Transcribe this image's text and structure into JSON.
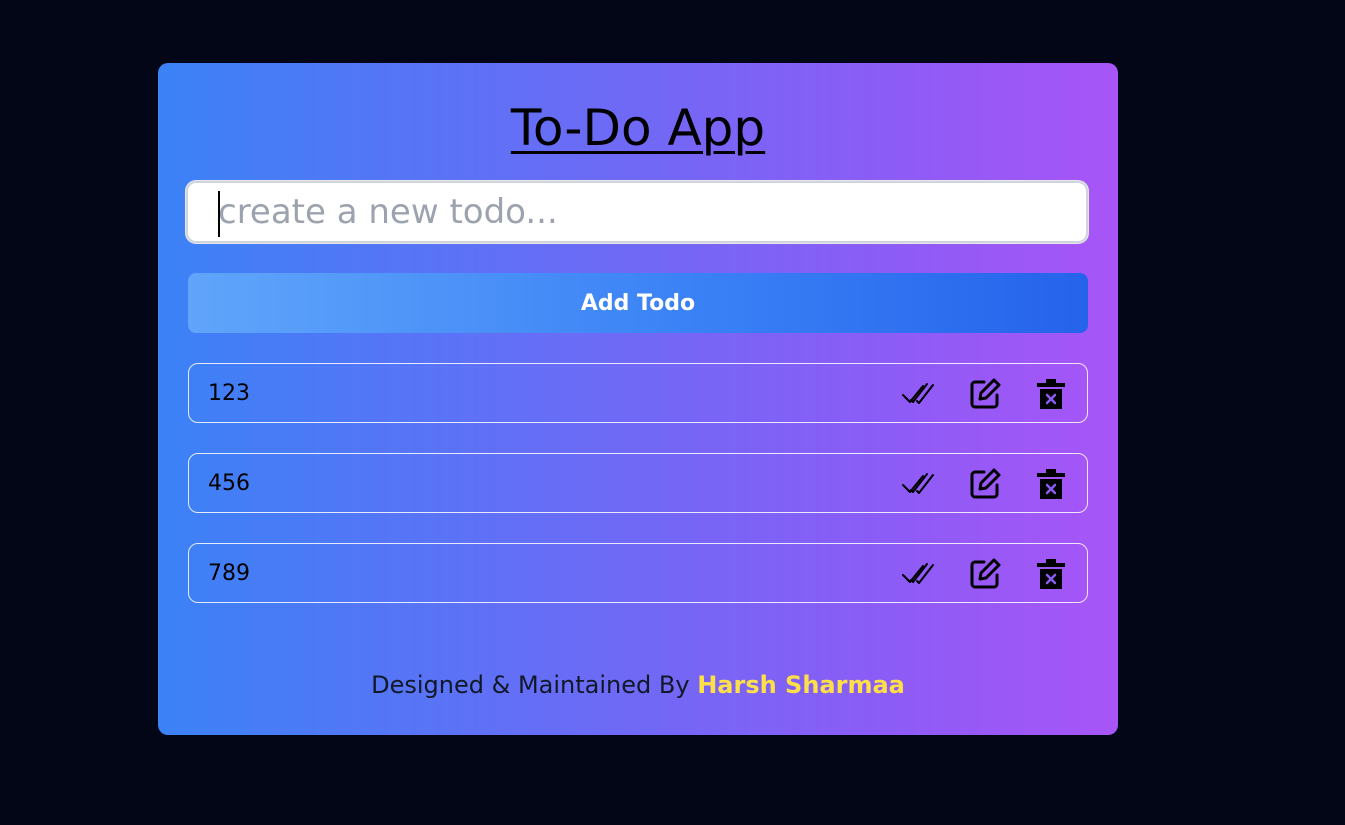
{
  "app": {
    "title": "To-Do App"
  },
  "input": {
    "value": "",
    "placeholder": "create a new todo..."
  },
  "add_button": {
    "label": "Add Todo"
  },
  "todos": [
    {
      "text": "123"
    },
    {
      "text": "456"
    },
    {
      "text": "789"
    }
  ],
  "todo_actions": {
    "complete_icon": "double-check-icon",
    "edit_icon": "edit-icon",
    "delete_icon": "trash-icon"
  },
  "footer": {
    "prefix": "Designed & Maintained By",
    "author": "Harsh Sharmaa"
  },
  "colors": {
    "background": "#020617",
    "card_gradient_start": "#3b82f6",
    "card_gradient_end": "#a855f7",
    "button_gradient_start": "#60a5fa",
    "button_gradient_end": "#2563eb",
    "author_color": "#fde047"
  }
}
